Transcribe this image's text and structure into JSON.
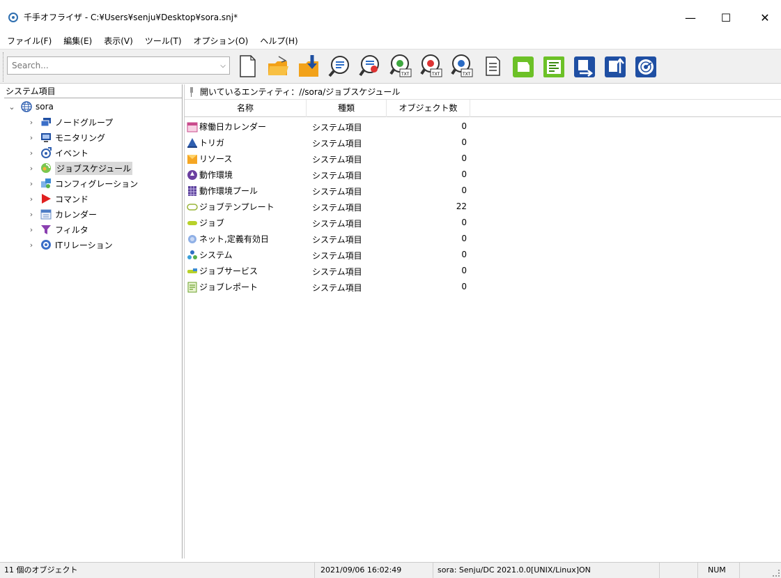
{
  "window": {
    "title": "千手オフライザ - C:¥Users¥senju¥Desktop¥sora.snj*",
    "minimize_label": "—",
    "maximize_label": "☐",
    "close_label": "✕"
  },
  "menu": [
    "ファイル(F)",
    "編集(E)",
    "表示(V)",
    "ツール(T)",
    "オプション(O)",
    "ヘルプ(H)"
  ],
  "toolbar": {
    "search_placeholder": "Search...",
    "search_value": "",
    "buttons": [
      "new-document-icon",
      "open-folder-icon",
      "import-icon",
      "search-doc-icon",
      "search-red-icon",
      "txt-green-icon",
      "txt-red-icon",
      "txt-blue-icon",
      "list-doc-icon",
      "green-node-icon",
      "green-list-icon",
      "export-blue-icon",
      "export-up-icon",
      "radar-icon"
    ]
  },
  "left_pane": {
    "header": "システム項目",
    "root": {
      "label": "sora",
      "icon": "globe-icon"
    },
    "items": [
      {
        "label": "ノードグループ",
        "icon": "node-group-icon"
      },
      {
        "label": "モニタリング",
        "icon": "monitoring-icon"
      },
      {
        "label": "イベント",
        "icon": "event-icon"
      },
      {
        "label": "ジョブスケジュール",
        "icon": "job-schedule-icon",
        "selected": true
      },
      {
        "label": "コンフィグレーション",
        "icon": "configuration-icon"
      },
      {
        "label": "コマンド",
        "icon": "command-icon"
      },
      {
        "label": "カレンダー",
        "icon": "calendar-icon"
      },
      {
        "label": "フィルタ",
        "icon": "filter-icon"
      },
      {
        "label": "ITリレーション",
        "icon": "it-relation-icon"
      }
    ]
  },
  "right_pane": {
    "path_label": "開いているエンティティ：//sora/ジョブスケジュール",
    "columns": [
      "名称",
      "種類",
      "オブジェクト数"
    ],
    "rows": [
      {
        "name": "稼働日カレンダー",
        "type": "システム項目",
        "count": "0",
        "icon": "calendar-pink-icon"
      },
      {
        "name": "トリガ",
        "type": "システム項目",
        "count": "0",
        "icon": "trigger-icon"
      },
      {
        "name": "リソース",
        "type": "システム項目",
        "count": "0",
        "icon": "resource-icon"
      },
      {
        "name": "動作環境",
        "type": "システム項目",
        "count": "0",
        "icon": "environment-icon"
      },
      {
        "name": "動作環境プール",
        "type": "システム項目",
        "count": "0",
        "icon": "environment-pool-icon"
      },
      {
        "name": "ジョブテンプレート",
        "type": "システム項目",
        "count": "22",
        "icon": "job-template-icon"
      },
      {
        "name": "ジョブ",
        "type": "システム項目",
        "count": "0",
        "icon": "job-icon"
      },
      {
        "name": "ネット,定義有効日",
        "type": "システム項目",
        "count": "0",
        "icon": "net-definition-icon"
      },
      {
        "name": "システム",
        "type": "システム項目",
        "count": "0",
        "icon": "system-icon"
      },
      {
        "name": "ジョブサービス",
        "type": "システム項目",
        "count": "0",
        "icon": "job-service-icon"
      },
      {
        "name": "ジョブレポート",
        "type": "システム項目",
        "count": "0",
        "icon": "job-report-icon"
      }
    ]
  },
  "status": {
    "object_count": "11 個のオブジェクト",
    "datetime": "2021/09/06 16:02:49",
    "connection": "sora: Senju/DC 2021.0.0[UNIX/Linux]ON",
    "num": "NUM"
  }
}
